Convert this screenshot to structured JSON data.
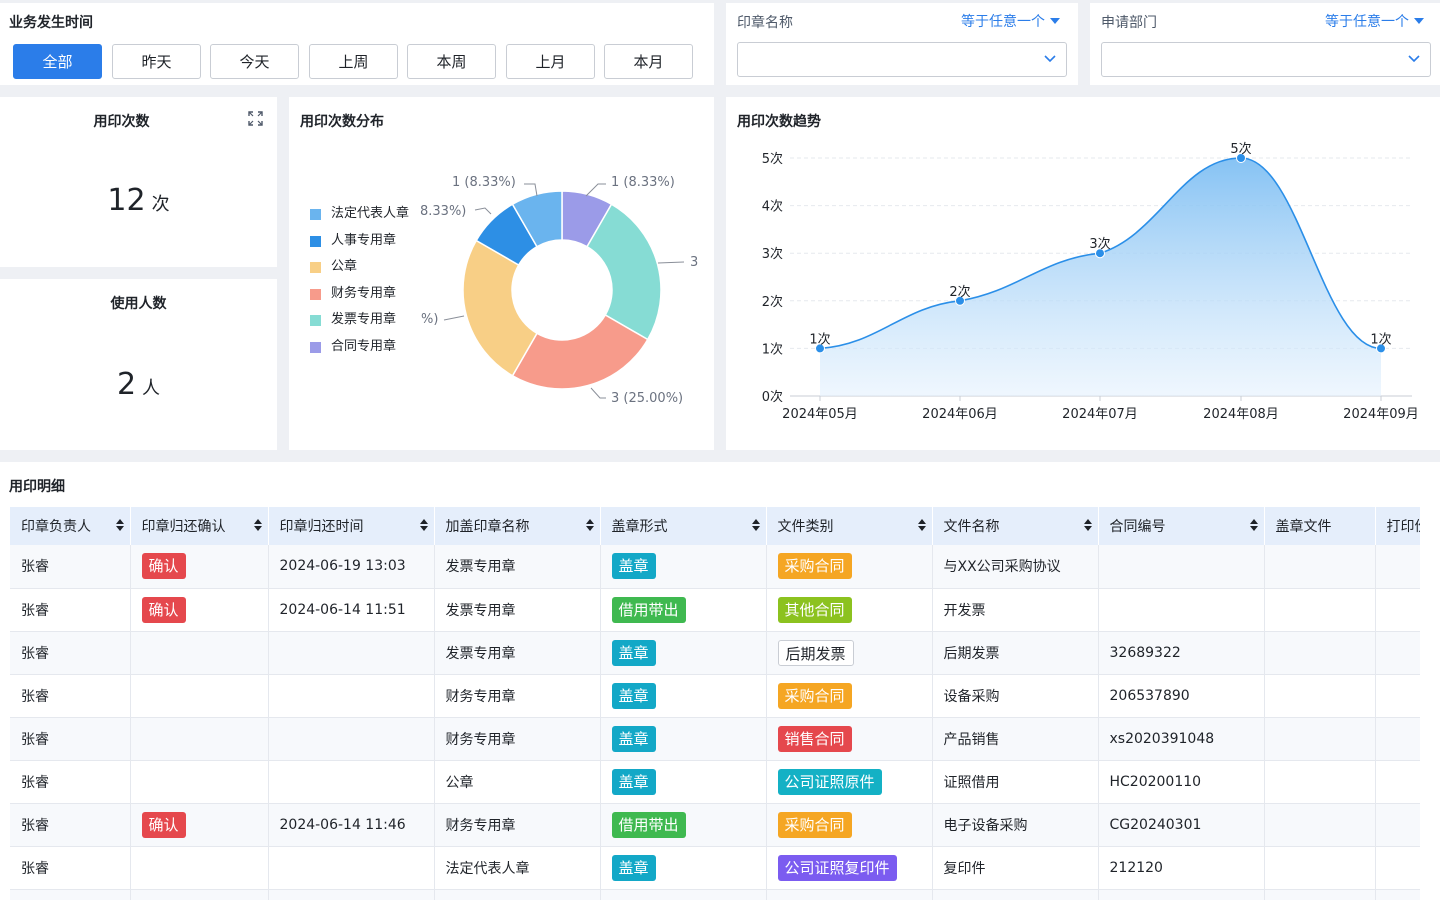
{
  "filters": {
    "time_title": "业务发生时间",
    "time_buttons": [
      "全部",
      "昨天",
      "今天",
      "上周",
      "本周",
      "上月",
      "本月"
    ],
    "active_index": 0,
    "seal_name": {
      "label": "印章名称",
      "operator": "等于任意一个",
      "value": ""
    },
    "department": {
      "label": "申请部门",
      "operator": "等于任意一个",
      "value": ""
    }
  },
  "kpi": {
    "seal_count": {
      "title": "用印次数",
      "value": "12",
      "unit": "次"
    },
    "users": {
      "title": "使用人数",
      "value": "2",
      "unit": "人"
    }
  },
  "distribution": {
    "title": "用印次数分布",
    "legend": [
      "法定代表人章",
      "人事专用章",
      "公章",
      "财务专用章",
      "发票专用章",
      "合同专用章"
    ],
    "labels": {
      "a": "1 (8.33%)",
      "b": "1 (8.33%)",
      "c": "8.33%)",
      "d": "3",
      "e": "%)",
      "f": "3 (25.00%)"
    }
  },
  "trend": {
    "title": "用印次数趋势",
    "y_ticks": [
      "0次",
      "1次",
      "2次",
      "3次",
      "4次",
      "5次"
    ],
    "x_ticks": [
      "2024年05月",
      "2024年06月",
      "2024年07月",
      "2024年08月",
      "2024年09月"
    ],
    "point_labels": [
      "1次",
      "2次",
      "3次",
      "5次",
      "1次"
    ]
  },
  "chart_data": [
    {
      "type": "pie",
      "title": "用印次数分布",
      "categories": [
        "合同专用章",
        "发票专用章",
        "财务专用章",
        "公章",
        "人事专用章",
        "法定代表人章"
      ],
      "values": [
        1,
        3,
        3,
        3,
        1,
        1
      ],
      "colors": [
        "#9b9be8",
        "#86dcd4",
        "#f79b8b",
        "#f8cf86",
        "#2d8fe5",
        "#6ab4ee"
      ]
    },
    {
      "type": "area",
      "title": "用印次数趋势",
      "categories": [
        "2024年05月",
        "2024年06月",
        "2024年07月",
        "2024年08月",
        "2024年09月"
      ],
      "values": [
        1,
        2,
        3,
        5,
        1
      ],
      "ylim": [
        0,
        5
      ],
      "grid": true,
      "color": "#2b8fe8"
    }
  ],
  "table": {
    "title": "用印明细",
    "columns": [
      "印章负责人",
      "印章归还确认",
      "印章归还时间",
      "加盖印章名称",
      "盖章形式",
      "文件类别",
      "文件名称",
      "合同编号",
      "盖章文件",
      "打印份"
    ],
    "rows": [
      {
        "owner": "张睿",
        "confirm": "确认",
        "time": "2024-06-19 13:03",
        "seal": "发票专用章",
        "form": "盖章",
        "form_color": "#13a8c7",
        "category": "采购合同",
        "cat_style": "orange",
        "file": "与XX公司采购协议",
        "contract": ""
      },
      {
        "owner": "张睿",
        "confirm": "确认",
        "time": "2024-06-14 11:51",
        "seal": "发票专用章",
        "form": "借用带出",
        "form_color": "#3fb950",
        "category": "其他合同",
        "cat_style": "lime",
        "file": "开发票",
        "contract": ""
      },
      {
        "owner": "张睿",
        "confirm": "",
        "time": "",
        "seal": "发票专用章",
        "form": "盖章",
        "form_color": "#13a8c7",
        "category": "后期发票",
        "cat_style": "outline",
        "file": "后期发票",
        "contract": "32689322"
      },
      {
        "owner": "张睿",
        "confirm": "",
        "time": "",
        "seal": "财务专用章",
        "form": "盖章",
        "form_color": "#13a8c7",
        "category": "采购合同",
        "cat_style": "orange",
        "file": "设备采购",
        "contract": "206537890"
      },
      {
        "owner": "张睿",
        "confirm": "",
        "time": "",
        "seal": "财务专用章",
        "form": "盖章",
        "form_color": "#13a8c7",
        "category": "销售合同",
        "cat_style": "red",
        "file": "产品销售",
        "contract": "xs2020391048"
      },
      {
        "owner": "张睿",
        "confirm": "",
        "time": "",
        "seal": "公章",
        "form": "盖章",
        "form_color": "#13a8c7",
        "category": "公司证照原件",
        "cat_style": "teal",
        "file": "证照借用",
        "contract": "HC20200110"
      },
      {
        "owner": "张睿",
        "confirm": "确认",
        "time": "2024-06-14 11:46",
        "seal": "财务专用章",
        "form": "借用带出",
        "form_color": "#3fb950",
        "category": "采购合同",
        "cat_style": "orange",
        "file": "电子设备采购",
        "contract": "CG20240301"
      },
      {
        "owner": "张睿",
        "confirm": "",
        "time": "",
        "seal": "法定代表人章",
        "form": "盖章",
        "form_color": "#13a8c7",
        "category": "公司证照复印件",
        "cat_style": "purple",
        "file": "复印件",
        "contract": "212120"
      }
    ]
  },
  "colors": {
    "primary": "#2b7de9",
    "confirm": "#e5484d",
    "orange": "#f5a623",
    "lime": "#8cc21f",
    "red": "#e5484d",
    "teal": "#14b1c5",
    "purple": "#7b5cf0"
  }
}
